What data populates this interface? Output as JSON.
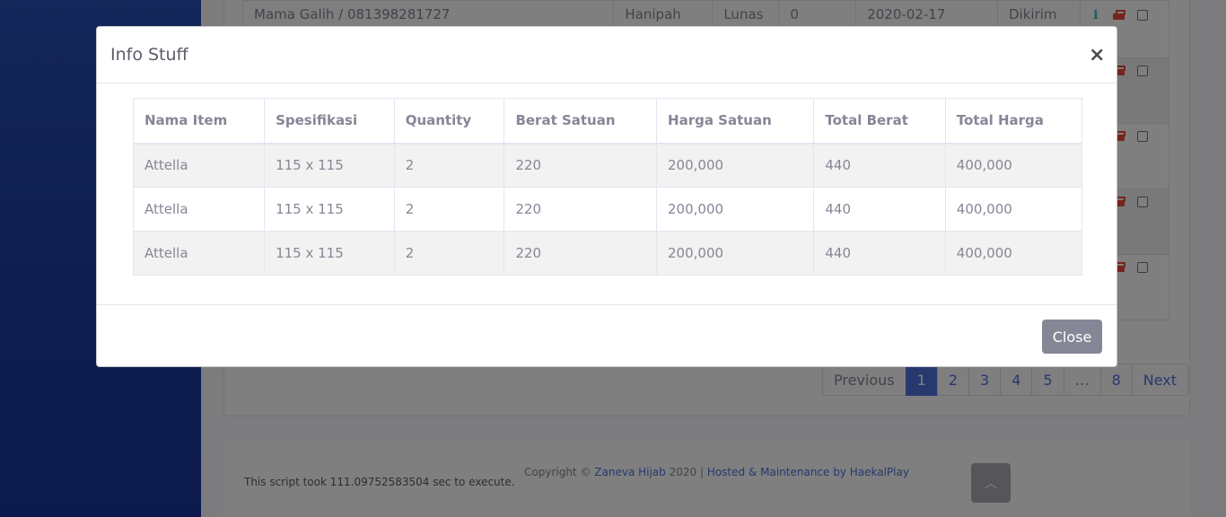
{
  "background": {
    "table_rows": [
      {
        "customer": "Mama Galih / 081398281727",
        "admin": "Hanipah",
        "payment": "Lunas",
        "num": "0",
        "date": "2020-02-17",
        "status": "Dikirim"
      },
      {
        "customer": "",
        "admin": "",
        "payment": "",
        "num": "",
        "date": "",
        "status": ""
      },
      {
        "customer": "",
        "admin": "",
        "payment": "",
        "num": "",
        "date": "",
        "status": ""
      },
      {
        "customer": "",
        "admin": "",
        "payment": "",
        "num": "",
        "date": "",
        "status": ""
      },
      {
        "customer": "",
        "admin": "",
        "payment": "",
        "num": "",
        "date": "",
        "status": ""
      }
    ],
    "pagination": {
      "previous": "Previous",
      "pages": [
        "1",
        "2",
        "3",
        "4",
        "5",
        "…",
        "8"
      ],
      "active": "1",
      "next": "Next"
    },
    "footer": {
      "exec_time": "This script took 111.09752583504 sec to execute.",
      "copyright_prefix": "Copyright ©",
      "brand": "Zaneva Hijab",
      "year_sep": " 2020 | ",
      "hosted": "Hosted & Maintenance by HaekalPlay"
    },
    "scroll_top_icon": "chevron-up-icon"
  },
  "modal": {
    "title": "Info Stuff",
    "close_symbol": "×",
    "close_button": "Close",
    "columns": [
      "Nama Item",
      "Spesifikasi",
      "Quantity",
      "Berat Satuan",
      "Harga Satuan",
      "Total Berat",
      "Total Harga"
    ],
    "rows": [
      [
        "Attella",
        "115 x 115",
        "2",
        "220",
        "200,000",
        "440",
        "400,000"
      ],
      [
        "Attella",
        "115 x 115",
        "2",
        "220",
        "200,000",
        "440",
        "400,000"
      ],
      [
        "Attella",
        "115 x 115",
        "2",
        "220",
        "200,000",
        "440",
        "400,000"
      ]
    ]
  },
  "colors": {
    "sidebar": "#224abe",
    "primary": "#4e73df",
    "secondary": "#858796",
    "danger": "#e74a3b",
    "info": "#36b9cc"
  }
}
